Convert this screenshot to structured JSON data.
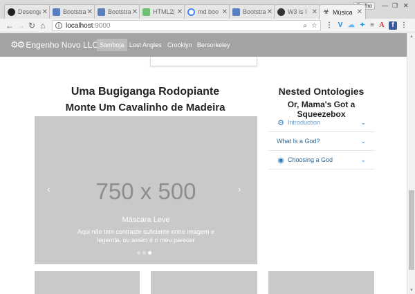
{
  "browser": {
    "tabs": [
      {
        "title": "Desenga",
        "favicon": "github-icon",
        "color": "#222222"
      },
      {
        "title": "Bootstra",
        "favicon": "bootstrap-icon",
        "color": "#5a7fbf"
      },
      {
        "title": "Bootstra",
        "favicon": "bootstrap-icon",
        "color": "#5a7fbf"
      },
      {
        "title": "HTML2|",
        "favicon": "html2-icon",
        "color": "#6fbf73"
      },
      {
        "title": "md boo",
        "favicon": "google-icon",
        "color": "#4285f4"
      },
      {
        "title": "Bootstra",
        "favicon": "bootstrap-icon",
        "color": "#5a7fbf"
      },
      {
        "title": "W3 is I",
        "favicon": "w3-icon",
        "color": "#333333"
      },
      {
        "title": "Música",
        "favicon": "biohazard-icon",
        "color": "#222222"
      }
    ],
    "profile_name": "Guilho",
    "url_host": "localhost",
    "url_port": ":9000"
  },
  "navbar": {
    "brand": "Engenho Novo LLC",
    "links": [
      "Samboja",
      "Lost Angles",
      "Crooklyn",
      "Bersorkeley"
    ],
    "active_index": 0
  },
  "main": {
    "heading": "Uma Bugiganga Rodopiante",
    "subheading": "Monte Um Cavalinho de Madeira",
    "carousel": {
      "placeholder": "750 x 500",
      "caption_title": "Máscara Leve",
      "caption_line1": "Aqui não tem contraste suficiente entre imagem e",
      "caption_line2": "legenda, ou assim é o meu parecer",
      "slides": 3,
      "active_slide": 2
    }
  },
  "sidebar": {
    "heading": "Nested Ontologies",
    "subheading": "Or, Mama's Got a Squeezebox",
    "items": [
      {
        "label": "Introduction",
        "icon": "gears-icon"
      },
      {
        "label": "What Is a God?",
        "icon": ""
      },
      {
        "label": "Choosing a God",
        "icon": "lifebuoy-icon"
      }
    ]
  },
  "colors": {
    "navbar": "#a3a3a3",
    "placeholder": "#c9c9c9",
    "link": "#337ab7"
  }
}
